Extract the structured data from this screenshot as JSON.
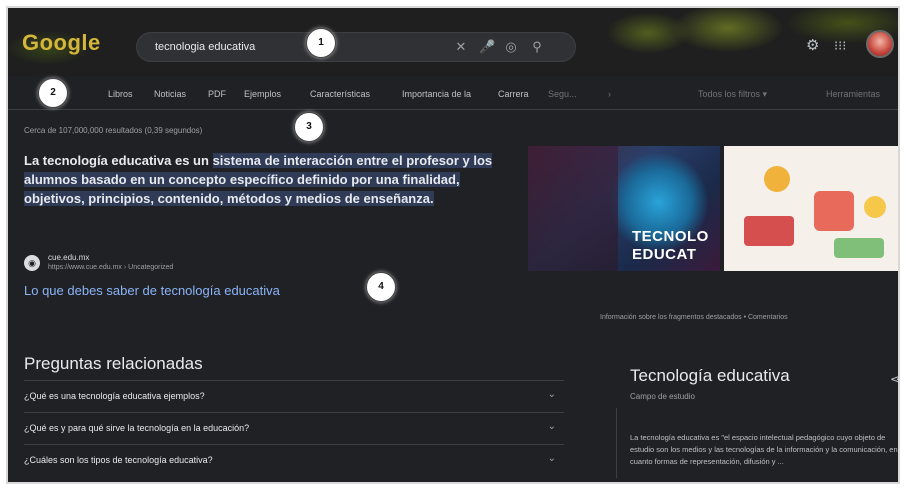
{
  "header": {
    "logo": "Google",
    "search_query": "tecnologia educativa",
    "icons": [
      "close-icon",
      "mic-icon",
      "lens-icon",
      "search-icon",
      "settings-icon",
      "apps-icon"
    ]
  },
  "badges": [
    "1",
    "2",
    "3",
    "4"
  ],
  "tabs": [
    {
      "label": "Libros"
    },
    {
      "label": "Noticias"
    },
    {
      "label": "PDF"
    },
    {
      "label": "Ejemplos"
    },
    {
      "label": "Características"
    },
    {
      "label": "Importancia de la"
    },
    {
      "label": "Carrera"
    },
    {
      "label": "Segu..."
    },
    {
      "label": "Todos los filtros ▾"
    },
    {
      "label": "Herramientas"
    }
  ],
  "results": {
    "stats": "Cerca de 107,000,000 resultados (0,39 segundos)",
    "snippet_plain": "La tecnología educativa es un ",
    "snippet_highlight": "sistema de interacción entre el profesor y los alumnos basado en un concepto específico definido por una finalidad, objetivos, principios, contenido, métodos y medios de enseñanza.",
    "site_name": "cue.edu.mx",
    "site_url": "https://www.cue.edu.mx › Uncategorized",
    "link_title": "Lo que debes saber de tecnología educativa",
    "image_caption": "TECNOLO EDUCAT",
    "feedback": "Información sobre los fragmentos destacados  •  Comentarios"
  },
  "paa": {
    "title": "Preguntas relacionadas",
    "questions": [
      "¿Qué es una tecnología educativa ejemplos?",
      "¿Qué es y para qué sirve la tecnología en la educación?",
      "¿Cuáles son los tipos de tecnología educativa?"
    ]
  },
  "knowledge_panel": {
    "title": "Tecnología educativa",
    "subtitle": "Campo de estudio",
    "description": "La tecnología educativa es \"el espacio intelectual pedagógico cuyo objeto de estudio son los medios y las tecnologías de la información y la comunicación, en cuanto formas de representación, difusión y ..."
  },
  "colors": {
    "background": "#202124",
    "link": "#8ab4f8",
    "highlight": "#2f3b57"
  }
}
